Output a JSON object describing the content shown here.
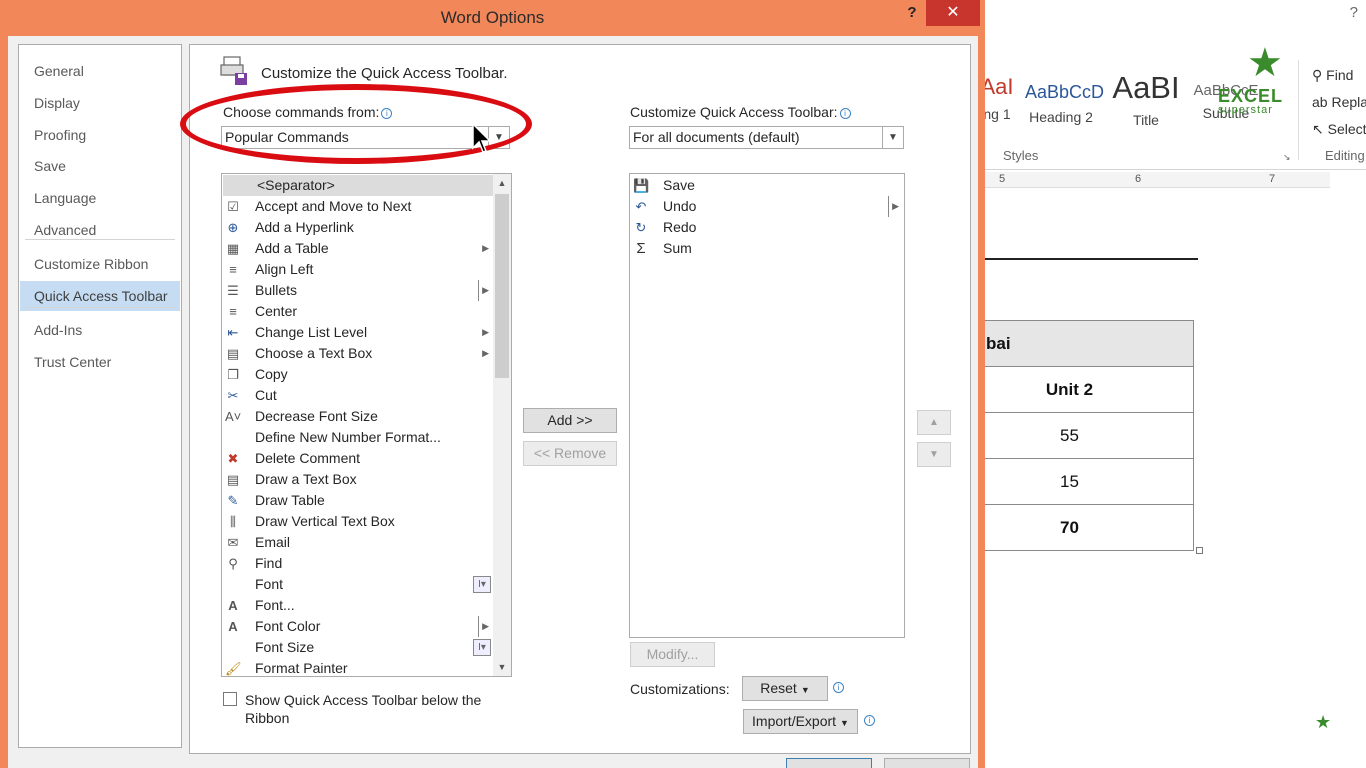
{
  "dialog": {
    "title": "Word Options",
    "help": "?",
    "close": "✕"
  },
  "nav": {
    "items": [
      {
        "label": "General"
      },
      {
        "label": "Display"
      },
      {
        "label": "Proofing"
      },
      {
        "label": "Save"
      },
      {
        "label": "Language"
      },
      {
        "label": "Advanced"
      },
      {
        "label": "Customize Ribbon"
      },
      {
        "label": "Quick Access Toolbar"
      },
      {
        "label": "Add-Ins"
      },
      {
        "label": "Trust Center"
      }
    ],
    "selected": "Quick Access Toolbar"
  },
  "main": {
    "heading": "Customize the Quick Access Toolbar.",
    "choose_label": "Choose commands from:",
    "choose_value": "Popular Commands",
    "customize_label": "Customize Quick Access Toolbar:",
    "customize_value": "For all documents (default)",
    "commands": [
      {
        "label": "<Separator>",
        "icon": "none"
      },
      {
        "label": "Accept and Move to Next",
        "icon": "accept-icon"
      },
      {
        "label": "Add a Hyperlink",
        "icon": "hyperlink-icon"
      },
      {
        "label": "Add a Table",
        "icon": "table-icon"
      },
      {
        "label": "Align Left",
        "icon": "align-left-icon"
      },
      {
        "label": "Bullets",
        "icon": "bullets-icon"
      },
      {
        "label": "Center",
        "icon": "center-icon"
      },
      {
        "label": "Change List Level",
        "icon": "list-level-icon"
      },
      {
        "label": "Choose a Text Box",
        "icon": "text-box-icon"
      },
      {
        "label": "Copy",
        "icon": "copy-icon"
      },
      {
        "label": "Cut",
        "icon": "cut-icon"
      },
      {
        "label": "Decrease Font Size",
        "icon": "decrease-font-icon"
      },
      {
        "label": "Define New Number Format...",
        "icon": "none"
      },
      {
        "label": "Delete Comment",
        "icon": "delete-comment-icon"
      },
      {
        "label": "Draw a Text Box",
        "icon": "draw-text-box-icon"
      },
      {
        "label": "Draw Table",
        "icon": "draw-table-icon"
      },
      {
        "label": "Draw Vertical Text Box",
        "icon": "vertical-text-box-icon"
      },
      {
        "label": "Email",
        "icon": "email-icon"
      },
      {
        "label": "Find",
        "icon": "find-icon"
      },
      {
        "label": "Font",
        "icon": "none"
      },
      {
        "label": "Font...",
        "icon": "font-dialog-icon"
      },
      {
        "label": "Font Color",
        "icon": "font-color-icon"
      },
      {
        "label": "Font Size",
        "icon": "none"
      },
      {
        "label": "Format Painter",
        "icon": "format-painter-icon"
      }
    ],
    "qat_items": [
      {
        "label": "Save",
        "icon": "save-icon"
      },
      {
        "label": "Undo",
        "icon": "undo-icon"
      },
      {
        "label": "Redo",
        "icon": "redo-icon"
      },
      {
        "label": "Sum",
        "icon": "sum-icon"
      }
    ],
    "add_button": "Add >>",
    "remove_button": "<< Remove",
    "modify_button": "Modify...",
    "customizations_label": "Customizations:",
    "reset_button": "Reset",
    "import_export_button": "Import/Export",
    "show_below_label": "Show Quick Access Toolbar below the Ribbon"
  },
  "word_bg": {
    "styles": [
      {
        "preview": "AaI",
        "name": "ng 1"
      },
      {
        "preview": "AaBbCcD",
        "name": "Heading 2"
      },
      {
        "preview": "AaBI",
        "name": "Title"
      },
      {
        "preview": "AaBbCcE",
        "name": "Subtitle"
      }
    ],
    "styles_group": "Styles",
    "editing": {
      "find": "Find",
      "replace": "Replace",
      "select": "Select",
      "group": "Editing"
    },
    "ruler_marks": [
      "5",
      "6",
      "7"
    ],
    "logo": {
      "line1": "EXCEL",
      "line2": "superstar"
    },
    "table": {
      "header": "bai",
      "unit": "Unit 2",
      "values": [
        "55",
        "15"
      ],
      "total": "70"
    }
  }
}
